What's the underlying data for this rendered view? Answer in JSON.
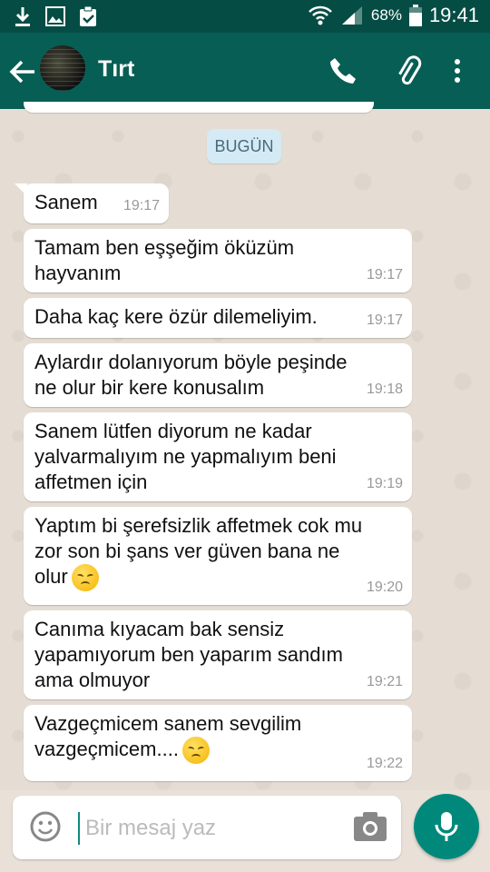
{
  "status_bar": {
    "battery": "68%",
    "time": "19:41"
  },
  "header": {
    "contact_name": "Tırt"
  },
  "chat": {
    "date_chip": "BUGÜN",
    "messages": [
      {
        "text": "Sanem",
        "time": "19:17"
      },
      {
        "text": "Tamam ben eşşeğim öküzüm\nhayvanım",
        "time": "19:17"
      },
      {
        "text": "Daha kaç kere özür dilemeliyim.",
        "time": "19:17"
      },
      {
        "text": "Aylardır dolanıyorum böyle peşinde\nne olur bir kere konusalım",
        "time": "19:18"
      },
      {
        "text": "Sanem lütfen diyorum ne kadar\nyalvarmalıyım ne yapmalıyım beni\naffetmen için",
        "time": "19:19"
      },
      {
        "text": "Yaptım bi şerefsizlik affetmek cok mu\nzor son bi şans ver güven bana ne\nolur",
        "time": "19:20",
        "emoji": "disappointed-face"
      },
      {
        "text": "Canıma kıyacam bak sensiz\nyapamıyorum ben yaparım sandım\nama olmuyor",
        "time": "19:21"
      },
      {
        "text": "Vazgeçmicem sanem sevgilim\nvazgeçmicem....",
        "time": "19:22",
        "emoji": "disappointed-face"
      }
    ]
  },
  "composer": {
    "placeholder": "Bir mesaj yaz"
  },
  "colors": {
    "header": "#075e54",
    "statusbar": "#054d44",
    "fab": "#00897b",
    "chat_bg": "#e5ddd3"
  }
}
